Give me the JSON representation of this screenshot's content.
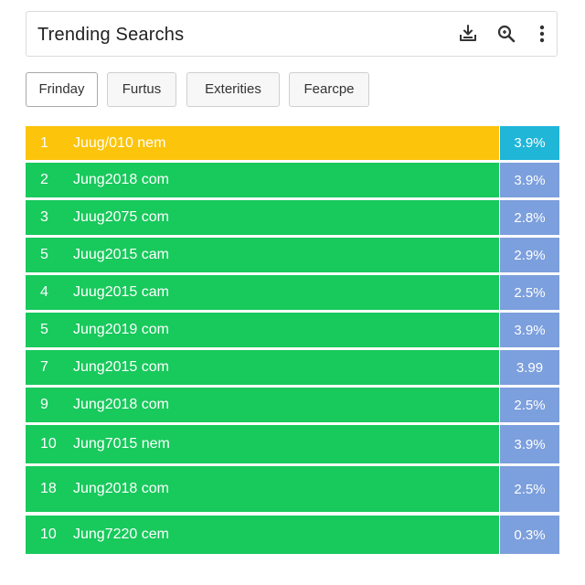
{
  "header": {
    "title": "Trending Searchs",
    "icons": [
      "download-icon",
      "search-icon",
      "more-vertical-icon"
    ]
  },
  "filters": [
    {
      "label": "Frinday",
      "active": true
    },
    {
      "label": "Furtus",
      "active": false
    },
    {
      "label": "Exterities",
      "active": false
    },
    {
      "label": "Fearcpe",
      "active": false
    }
  ],
  "colors": {
    "highlight_row": "#fcc40b",
    "highlight_pct": "#1fb6d8",
    "row": "#18c95c",
    "pct": "#7c9fdd"
  },
  "rows": [
    {
      "rank": "1",
      "term": "Juug/010 nem",
      "pct": "3.9%",
      "highlight": true
    },
    {
      "rank": "2",
      "term": "Jung2018 com",
      "pct": "3.9%",
      "highlight": false
    },
    {
      "rank": "3",
      "term": "Juug2075 com",
      "pct": "2.8%",
      "highlight": false
    },
    {
      "rank": "5",
      "term": "Juug2015 cam",
      "pct": "2.9%",
      "highlight": false
    },
    {
      "rank": "4",
      "term": "Juug2015 cam",
      "pct": "2.5%",
      "highlight": false
    },
    {
      "rank": "5",
      "term": "Jung2019 com",
      "pct": "3.9%",
      "highlight": false
    },
    {
      "rank": "7",
      "term": "Jung2015 com",
      "pct": "3.99",
      "highlight": false
    },
    {
      "rank": "9",
      "term": "Jung2018 com",
      "pct": "2.5%",
      "highlight": false
    },
    {
      "rank": "10",
      "term": "Jung7015 nem",
      "pct": "3.9%",
      "highlight": false
    },
    {
      "rank": "18",
      "term": "Jung2018 com",
      "pct": "2.5%",
      "highlight": false
    },
    {
      "rank": "10",
      "term": "Jung7220 cem",
      "pct": "0.3%",
      "highlight": false
    }
  ]
}
